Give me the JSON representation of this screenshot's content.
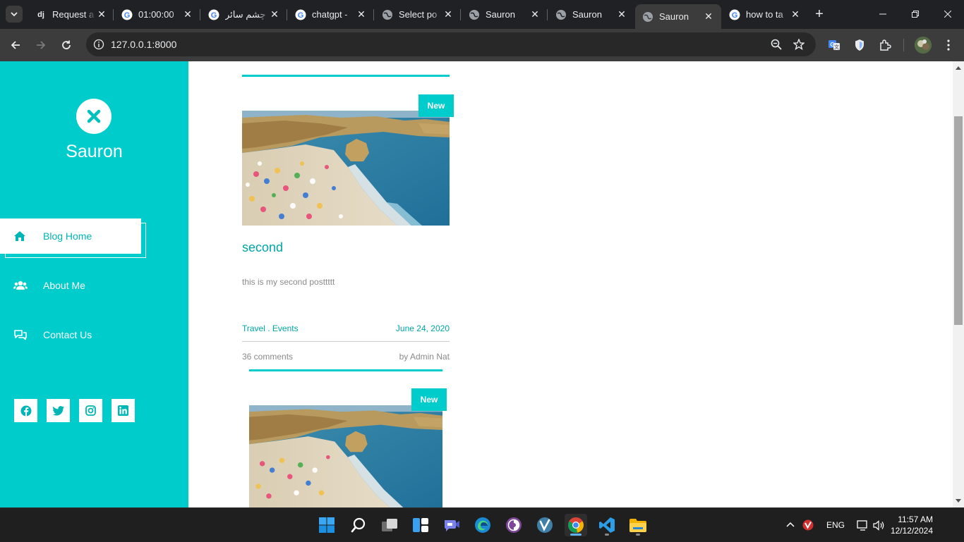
{
  "browser": {
    "tabs": [
      {
        "title": "Request a",
        "favicon": "django-icon",
        "active": false
      },
      {
        "title": "01:00:00",
        "favicon": "google-icon",
        "active": false
      },
      {
        "title": "چشم سائر",
        "favicon": "google-icon",
        "active": false
      },
      {
        "title": "chatgpt -",
        "favicon": "google-icon",
        "active": false
      },
      {
        "title": "Select po",
        "favicon": "globe-icon",
        "active": false
      },
      {
        "title": "Sauron",
        "favicon": "globe-icon",
        "active": false
      },
      {
        "title": "Sauron",
        "favicon": "globe-icon",
        "active": false
      },
      {
        "title": "Sauron",
        "favicon": "globe-icon",
        "active": true
      },
      {
        "title": "how to ta",
        "favicon": "google-icon",
        "active": false
      }
    ],
    "url": "127.0.0.1:8000"
  },
  "sidebar": {
    "brand": "Sauron",
    "nav": [
      {
        "label": "Blog Home",
        "icon": "home-icon",
        "active": true
      },
      {
        "label": "About Me",
        "icon": "users-icon",
        "active": false
      },
      {
        "label": "Contact Us",
        "icon": "chat-icon",
        "active": false
      }
    ],
    "social": [
      "facebook-icon",
      "twitter-icon",
      "instagram-icon",
      "linkedin-icon"
    ]
  },
  "posts": [
    {
      "badge": "New",
      "title": "second",
      "excerpt": "this is my second posttttt",
      "categories": "Travel . Events",
      "date": "June 24, 2020",
      "comments": "36 comments",
      "author": "by Admin Nat"
    },
    {
      "badge": "New"
    }
  ],
  "taskbar": {
    "language": "ENG",
    "time": "11:57 AM",
    "date": "12/12/2024"
  },
  "colors": {
    "accent": "#00cccc",
    "browser_dark": "#202124"
  }
}
